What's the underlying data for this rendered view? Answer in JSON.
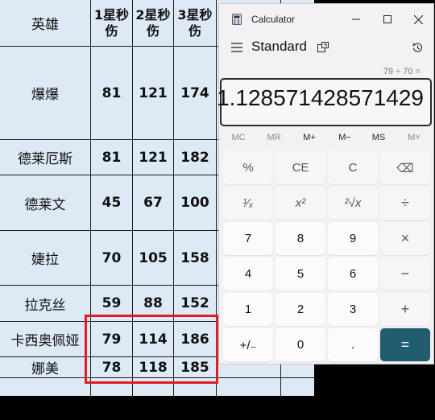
{
  "sheet": {
    "headers": [
      "英雄",
      "1星秒\n伤",
      "2星秒\n伤",
      "3星秒\n伤"
    ],
    "rows": [
      {
        "name": "爆爆",
        "v1": "81",
        "v2": "121",
        "v3": "174"
      },
      {
        "name": "德莱厄斯",
        "v1": "81",
        "v2": "121",
        "v3": "182"
      },
      {
        "name": "德莱文",
        "v1": "45",
        "v2": "67",
        "v3": "100"
      },
      {
        "name": "婕拉",
        "v1": "70",
        "v2": "105",
        "v3": "158"
      },
      {
        "name": "拉克丝",
        "v1": "59",
        "v2": "88",
        "v3": "152"
      },
      {
        "name": "卡西奥佩娅",
        "v1": "79",
        "v2": "114",
        "v3": "186"
      },
      {
        "name": "娜美",
        "v1": "78",
        "v2": "118",
        "v3": "185"
      }
    ],
    "highlight_color": "#e31b23"
  },
  "calc": {
    "window_title": "Calculator",
    "mode": "Standard",
    "expression": "79 ÷ 70 =",
    "result": "1.128571428571429",
    "memory": [
      "MC",
      "MR",
      "M+",
      "M−",
      "MS",
      "M˅"
    ],
    "keys": [
      [
        "%",
        "CE",
        "C",
        "⌫"
      ],
      [
        "¹⁄ₓ",
        "x²",
        "²√x",
        "÷"
      ],
      [
        "7",
        "8",
        "9",
        "×"
      ],
      [
        "4",
        "5",
        "6",
        "−"
      ],
      [
        "1",
        "2",
        "3",
        "+"
      ],
      [
        "+/₋",
        "0",
        ".",
        "="
      ]
    ],
    "accent": "#1f5d6f"
  }
}
